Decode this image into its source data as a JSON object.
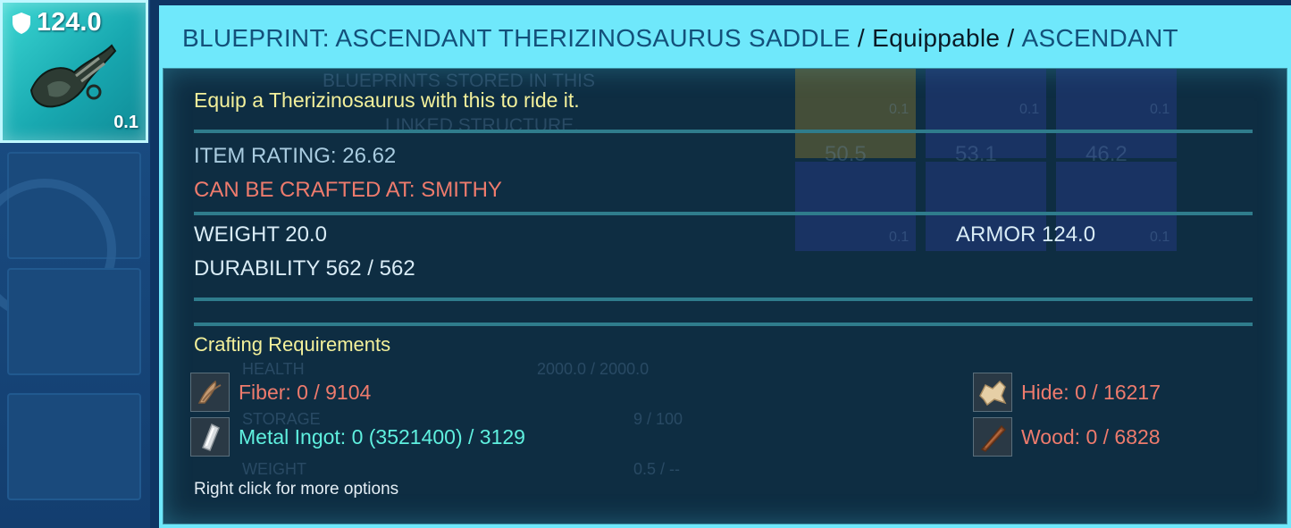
{
  "item_tile": {
    "armor": "124.0",
    "weight": "0.1",
    "icon": "saddle-icon"
  },
  "tooltip": {
    "title_prefix": "BLUEPRINT: ASCENDANT THERIZINOSAURUS SADDLE",
    "separator": "/",
    "type": "Equippable",
    "quality": "ASCENDANT",
    "description": "Equip a Therizinosaurus with this to ride it.",
    "item_rating": "ITEM RATING: 26.62",
    "crafted_at": "CAN BE CRAFTED AT: SMITHY",
    "weight": "WEIGHT 20.0",
    "armor": "ARMOR 124.0",
    "durability": "DURABILITY 562 / 562",
    "requirements_title": "Crafting Requirements",
    "requirements": [
      {
        "name": "Fiber: 0 / 9104",
        "icon": "fiber-icon",
        "color": "#ee7b6d"
      },
      {
        "name": "Hide: 0 / 16217",
        "icon": "hide-icon",
        "color": "#ee7b6d"
      },
      {
        "name": "Metal Ingot: 0 (3521400) / 3129",
        "icon": "metal-ingot-icon",
        "color": "#5ff0df"
      },
      {
        "name": "Wood: 0 / 6828",
        "icon": "wood-icon",
        "color": "#ee7b6d"
      }
    ],
    "hint": "Right click for more options"
  },
  "background": {
    "blueprint_note": [
      "BLUEPRINTS STORED IN THIS",
      "LINKED STRUCTURE."
    ],
    "slot_weights": [
      "0.1",
      "0.1",
      "0.1",
      "0.1",
      "0.1"
    ],
    "slot_armor": [
      "50.5",
      "53.1",
      "46.2"
    ],
    "stats": {
      "health_label": "HEALTH",
      "health_value": "2000.0 / 2000.0",
      "storage_label": "STORAGE",
      "storage_value": "9 / 100",
      "weight_label": "WEIGHT",
      "weight_value": "0.5 / --"
    }
  },
  "colors": {
    "tooltip_frame": "#6fe8fb",
    "title": "#13507a",
    "description": "#f3f09b",
    "missing_resource": "#ee7b6d",
    "available_resource": "#5ff0df"
  }
}
